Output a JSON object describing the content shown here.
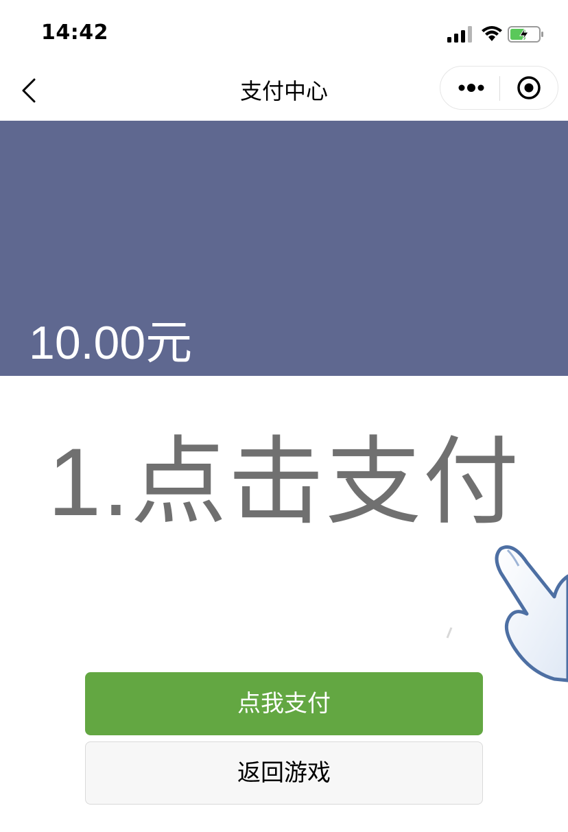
{
  "status_bar": {
    "time": "14:42",
    "icons": [
      "signal-icon",
      "wifi-icon",
      "battery-charging-icon"
    ]
  },
  "nav": {
    "title": "支付中心",
    "icons": [
      "back-arrow-icon",
      "more-dots-icon",
      "close-target-icon"
    ]
  },
  "banner": {
    "amount": "10.00元",
    "color": "#5f6890"
  },
  "instruction": {
    "text": "1.点击支付"
  },
  "buttons": {
    "pay_label": "点我支付",
    "back_label": "返回游戏",
    "pay_color": "#63a742"
  },
  "decor": {
    "pointer": "hand-pointer-icon"
  }
}
